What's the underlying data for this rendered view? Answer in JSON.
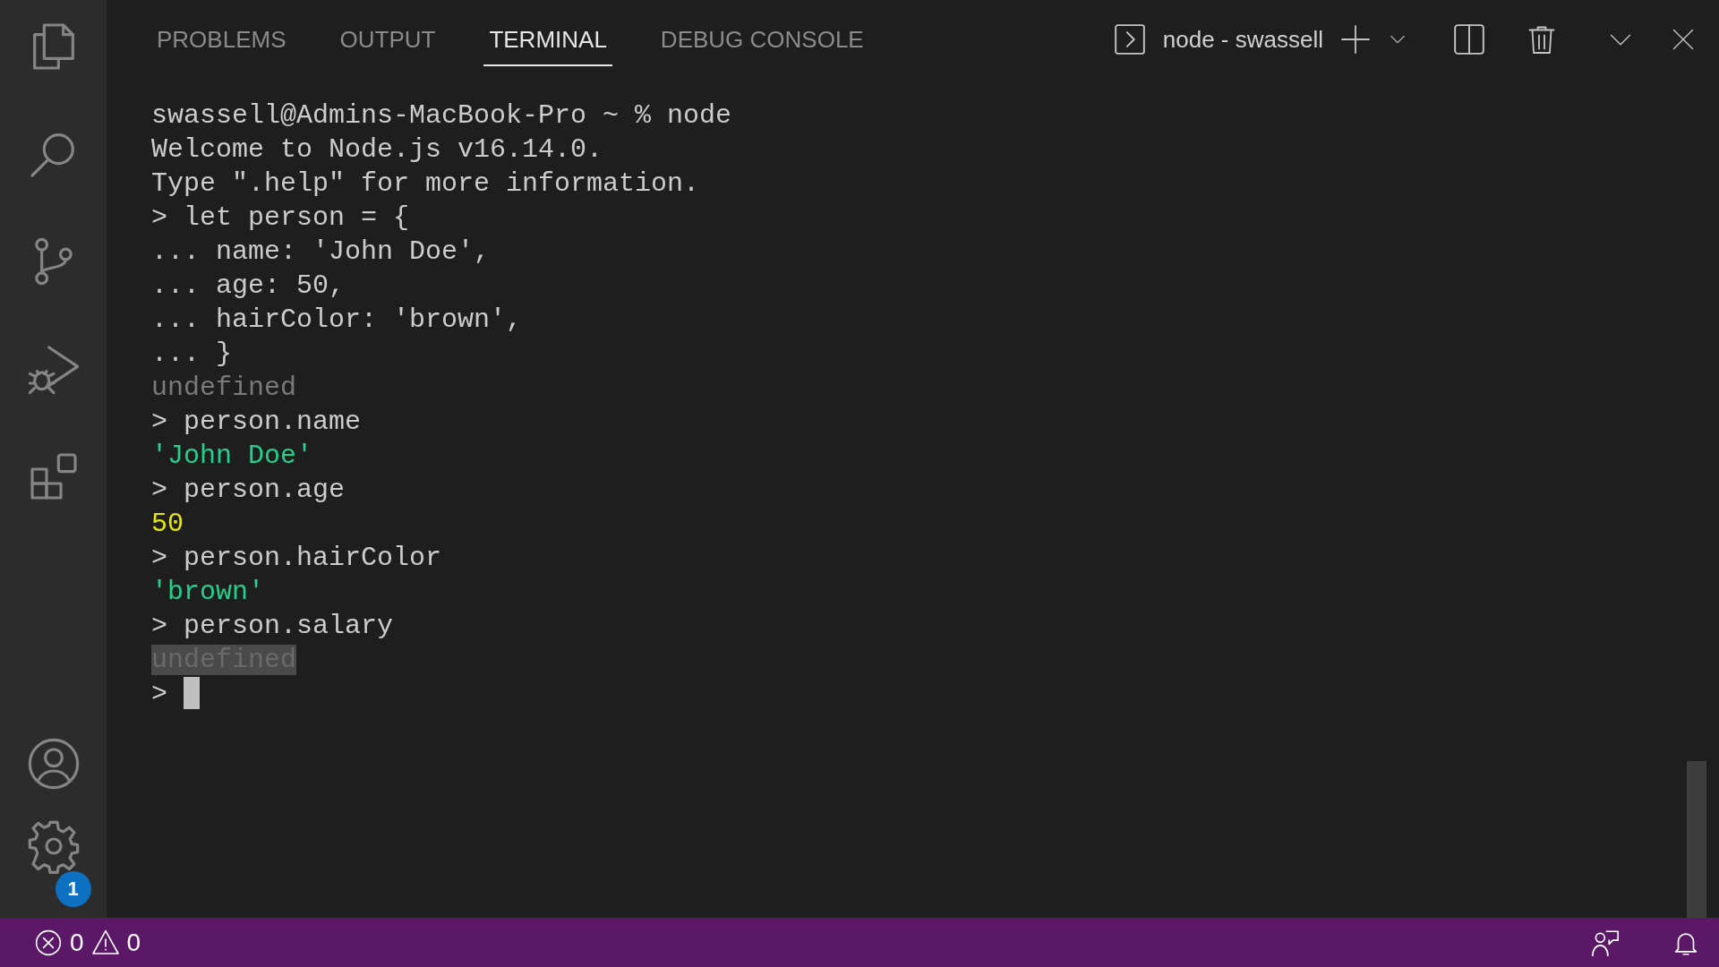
{
  "activity_bar": {
    "badge": "1"
  },
  "panel": {
    "tabs": [
      {
        "label": "PROBLEMS",
        "selected": false
      },
      {
        "label": "OUTPUT",
        "selected": false
      },
      {
        "label": "TERMINAL",
        "selected": true
      },
      {
        "label": "DEBUG CONSOLE",
        "selected": false
      }
    ],
    "terminal_name": "node - swassell"
  },
  "terminal": {
    "lines": [
      {
        "text": "swassell@Admins-MacBook-Pro ~ % node",
        "kind": "plain",
        "selected": false
      },
      {
        "text": "Welcome to Node.js v16.14.0.",
        "kind": "plain",
        "selected": false
      },
      {
        "text": "Type \".help\" for more information.",
        "kind": "plain",
        "selected": false
      },
      {
        "text": "> let person = {",
        "kind": "plain",
        "selected": false
      },
      {
        "text": "... name: 'John Doe',",
        "kind": "plain",
        "selected": false
      },
      {
        "text": "... age: 50,",
        "kind": "plain",
        "selected": false
      },
      {
        "text": "... hairColor: 'brown',",
        "kind": "plain",
        "selected": false
      },
      {
        "text": "... }",
        "kind": "plain",
        "selected": false
      },
      {
        "text": "undefined",
        "kind": "muted",
        "selected": false
      },
      {
        "text": "> person.name",
        "kind": "plain",
        "selected": false
      },
      {
        "text": "'John Doe'",
        "kind": "string",
        "selected": false
      },
      {
        "text": "> person.age",
        "kind": "plain",
        "selected": false
      },
      {
        "text": "50",
        "kind": "number",
        "selected": false
      },
      {
        "text": "> person.hairColor",
        "kind": "plain",
        "selected": false
      },
      {
        "text": "'brown'",
        "kind": "string",
        "selected": false
      },
      {
        "text": "> person.salary",
        "kind": "plain",
        "selected": false
      },
      {
        "text": "undefined",
        "kind": "muted",
        "selected": true
      },
      {
        "text": ">",
        "kind": "prompt",
        "selected": false
      }
    ]
  },
  "status_bar": {
    "errors": "0",
    "warnings": "0"
  }
}
